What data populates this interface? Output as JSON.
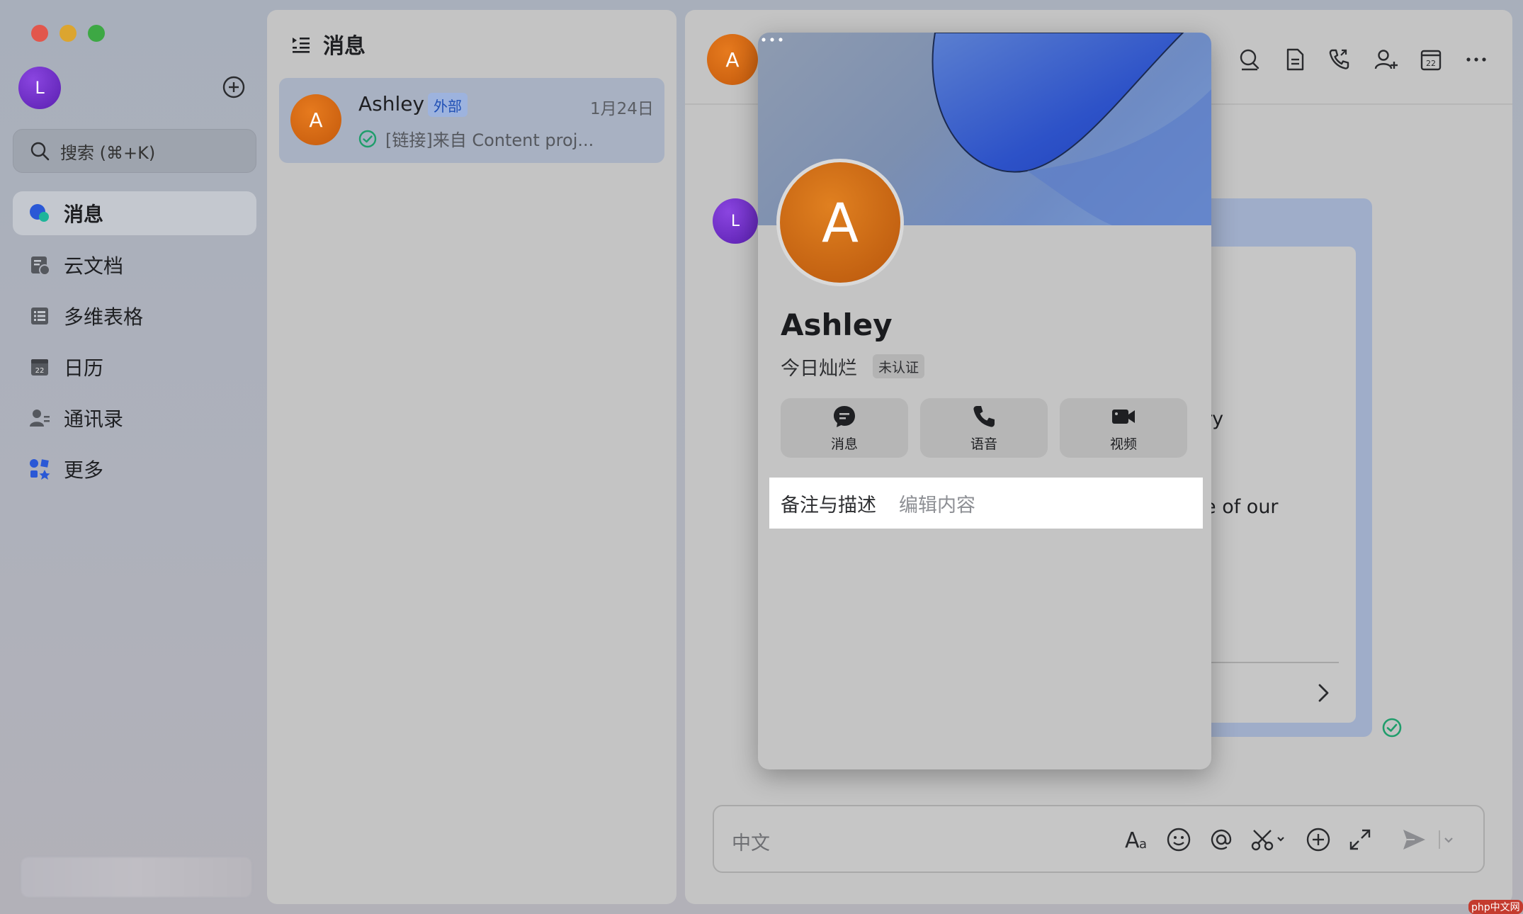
{
  "window": {
    "controls": [
      "close",
      "minimize",
      "zoom"
    ]
  },
  "user": {
    "avatar_letter": "L"
  },
  "search": {
    "placeholder": "搜索 (⌘+K)"
  },
  "sidebar": {
    "items": [
      {
        "label": "消息",
        "icon": "chat-bubble-icon",
        "active": true
      },
      {
        "label": "云文档",
        "icon": "cloud-doc-icon"
      },
      {
        "label": "多维表格",
        "icon": "base-table-icon"
      },
      {
        "label": "日历",
        "icon": "calendar-icon"
      },
      {
        "label": "通讯录",
        "icon": "contacts-icon"
      },
      {
        "label": "更多",
        "icon": "more-apps-icon"
      }
    ],
    "calendar_day": "22"
  },
  "conversations": {
    "header": "消息",
    "items": [
      {
        "avatar_letter": "A",
        "name": "Ashley",
        "badge": "外部",
        "date": "1月24日",
        "preview": "[链接]来自 Content proj..."
      }
    ]
  },
  "chat": {
    "avatar_letter": "A",
    "message_sender_letter": "L",
    "card_fragments": [
      "ry",
      "e of our"
    ],
    "composer_placeholder": "中文",
    "toolbar_icons": [
      "search-icon",
      "doc-icon",
      "call-icon",
      "add-member-icon",
      "calendar-icon",
      "more-icon"
    ],
    "calendar_day": "22"
  },
  "profile": {
    "avatar_letter": "A",
    "name": "Ashley",
    "signature": "今日灿烂",
    "verify_badge": "未认证",
    "actions": [
      {
        "label": "消息",
        "icon": "message-icon"
      },
      {
        "label": "语音",
        "icon": "phone-icon"
      },
      {
        "label": "视频",
        "icon": "video-icon"
      }
    ],
    "note_label": "备注与描述",
    "note_edit": "编辑内容"
  },
  "colors": {
    "accent_purple": "#6a2cd0",
    "accent_orange": "#d46a12",
    "badge_blue": "#1f4fb5",
    "check_green": "#1f9d6b"
  },
  "watermark": "php中文网"
}
